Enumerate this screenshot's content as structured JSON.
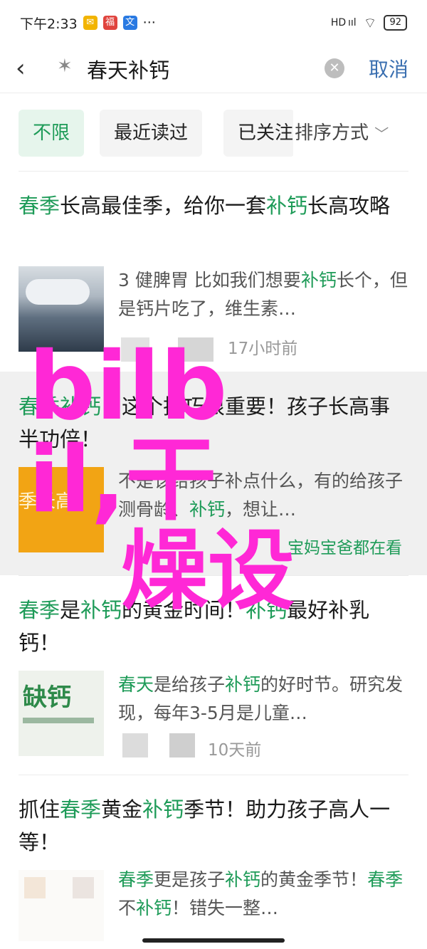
{
  "status_bar": {
    "time": "下午2:33",
    "dots": "···",
    "signal": "HD ııl",
    "wifi": "⌔",
    "battery": "92"
  },
  "search": {
    "query": "春天补钙",
    "cancel_label": "取消"
  },
  "filters": {
    "items": [
      "不限",
      "最近读过",
      "已关注"
    ],
    "sort_label": "排序方式"
  },
  "articles": [
    {
      "title_parts": [
        [
          "春季",
          true
        ],
        [
          "长高最佳季，给你一套",
          false
        ],
        [
          "补钙",
          true
        ],
        [
          "长高攻略",
          false
        ]
      ],
      "snippet_parts": [
        [
          "3 健脾胃 比如我们想要",
          false
        ],
        [
          "补钙",
          true
        ],
        [
          "长个，但是钙片吃了，维生素…",
          false
        ]
      ],
      "meta": "17小时前"
    },
    {
      "title_parts": [
        [
          "春季补钙",
          true
        ],
        [
          "，这个技巧很重要！孩子长高事半功倍！",
          false
        ]
      ],
      "snippet_parts": [
        [
          "不是该给孩子补点什么，有的给孩子测骨龄、",
          false
        ],
        [
          "补钙",
          true
        ],
        [
          "，想让…",
          false
        ]
      ],
      "meta": "宝妈宝爸都在看"
    },
    {
      "title_parts": [
        [
          "春季",
          true
        ],
        [
          "是",
          false
        ],
        [
          "补钙",
          true
        ],
        [
          "的黄金时间！",
          false
        ],
        [
          "补钙",
          true
        ],
        [
          "最好补乳钙！",
          false
        ]
      ],
      "snippet_parts": [
        [
          "春天",
          true
        ],
        [
          "是给孩子",
          false
        ],
        [
          "补钙",
          true
        ],
        [
          "的好时节。研究发现，每年3-5月是儿童…",
          false
        ]
      ],
      "meta": "10天前",
      "thumb_text": "缺钙"
    },
    {
      "title_parts": [
        [
          "抓住",
          false
        ],
        [
          "春季",
          true
        ],
        [
          "黄金",
          false
        ],
        [
          "补钙",
          true
        ],
        [
          "季节！助力孩子高人一等！",
          false
        ]
      ],
      "snippet_parts": [
        [
          "春季",
          true
        ],
        [
          "更是孩子",
          false
        ],
        [
          "补钙",
          true
        ],
        [
          "的黄金季节！",
          false
        ],
        [
          "春季",
          true
        ],
        [
          "不",
          false
        ],
        [
          "补钙",
          true
        ],
        [
          "！错失一整…",
          false
        ]
      ]
    }
  ],
  "watermark": {
    "line1": "bilb",
    "line2": "il,干",
    "line3": "燥设"
  },
  "colors": {
    "highlight": "#1e9b58",
    "watermark": "#ff28d6",
    "link": "#3a6fb0"
  }
}
